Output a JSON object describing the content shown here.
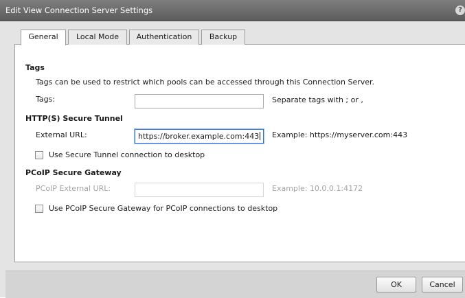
{
  "window": {
    "title": "Edit View Connection Server Settings",
    "help_icon": "?"
  },
  "tabs": [
    {
      "label": "General",
      "active": true
    },
    {
      "label": "Local Mode",
      "active": false
    },
    {
      "label": "Authentication",
      "active": false
    },
    {
      "label": "Backup",
      "active": false
    }
  ],
  "tags": {
    "heading": "Tags",
    "description": "Tags can be used to restrict which pools can be accessed through this Connection Server.",
    "field_label": "Tags:",
    "value": "",
    "hint": "Separate tags with ; or ,"
  },
  "secure_tunnel": {
    "heading": "HTTP(S) Secure Tunnel",
    "field_label": "External URL:",
    "value": "https://broker.example.com:443",
    "hint": "Example: https://myserver.com:443",
    "checkbox_label": "Use Secure Tunnel connection to desktop",
    "checked": false
  },
  "pcoip": {
    "heading": "PCoIP Secure Gateway",
    "field_label": "PCoIP External URL:",
    "value": "",
    "hint": "Example: 10.0.0.1:4172",
    "checkbox_label": "Use PCoIP Secure Gateway for PCoIP connections to desktop",
    "checked": false
  },
  "buttons": {
    "ok": "OK",
    "cancel": "Cancel"
  }
}
